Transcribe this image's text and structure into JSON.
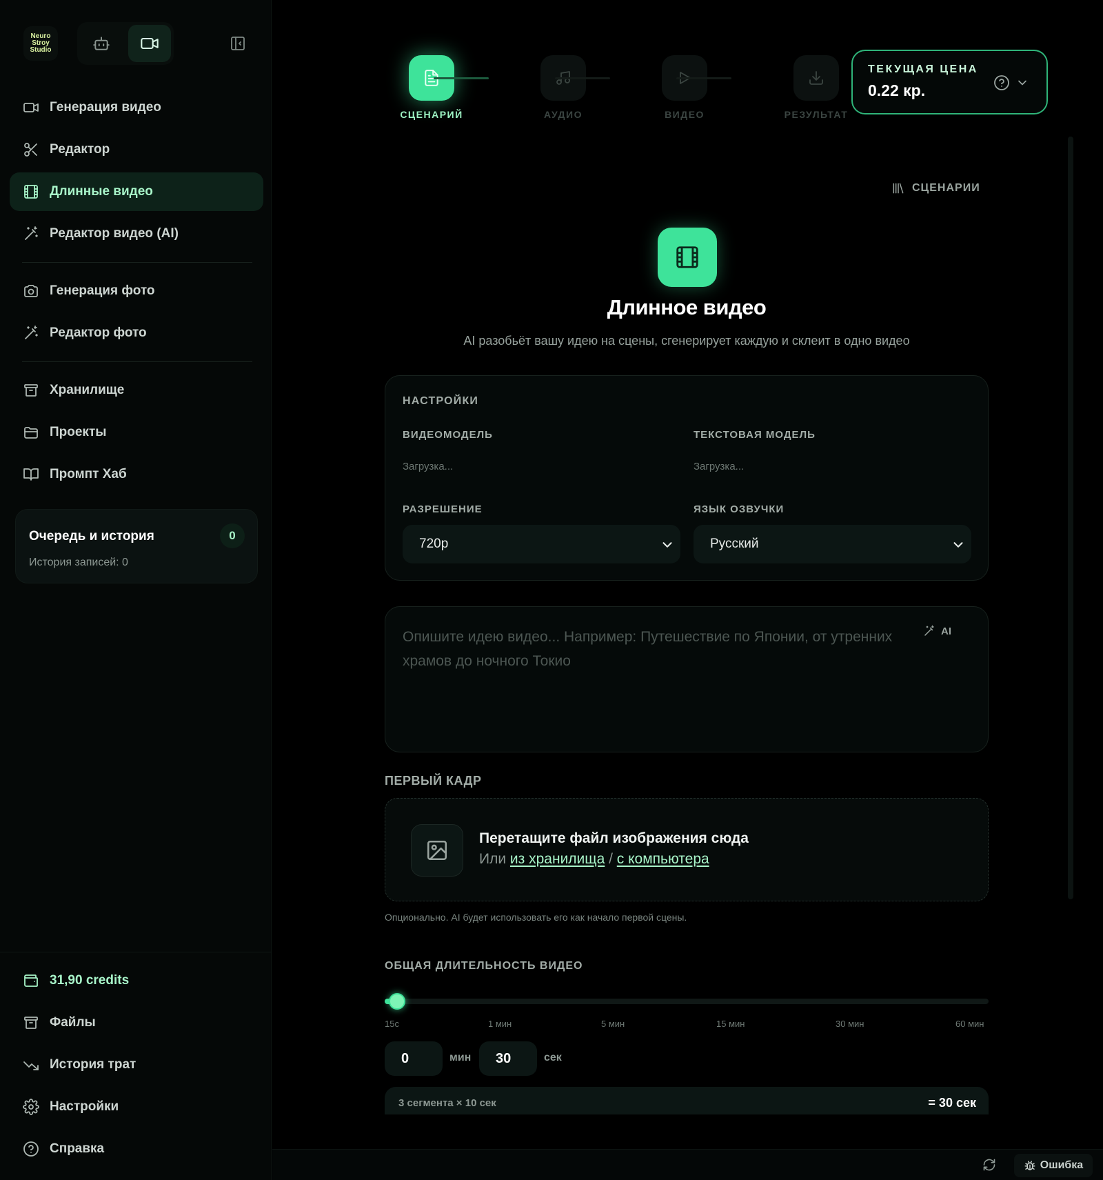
{
  "sidebar": {
    "logo_lines": [
      "Neuro",
      "Stroy",
      "Studio"
    ],
    "nav": [
      {
        "label": "Генерация видео",
        "icon": "video-icon",
        "active": false
      },
      {
        "label": "Редактор",
        "icon": "scissors-icon",
        "active": false
      },
      {
        "label": "Длинные видео",
        "icon": "film-icon",
        "active": true
      },
      {
        "label": "Редактор видео (AI)",
        "icon": "magic-wand-icon",
        "active": false
      },
      {
        "label": "Генерация фото",
        "icon": "camera-icon",
        "active": false
      },
      {
        "label": "Редактор фото",
        "icon": "magic-wand-icon",
        "active": false
      },
      {
        "label": "Хранилище",
        "icon": "archive-icon",
        "active": false
      },
      {
        "label": "Проекты",
        "icon": "folder-icon",
        "active": false
      },
      {
        "label": "Промпт Хаб",
        "icon": "book-icon",
        "active": false
      }
    ],
    "queue": {
      "title": "Очередь и история",
      "count": "0",
      "subtitle": "История записей: 0"
    },
    "bottom": [
      {
        "label": "31,90 credits",
        "icon": "wallet-icon"
      },
      {
        "label": "Файлы",
        "icon": "archive-icon"
      },
      {
        "label": "История трат",
        "icon": "trend-down-icon"
      },
      {
        "label": "Настройки",
        "icon": "gear-icon"
      },
      {
        "label": "Справка",
        "icon": "help-icon"
      }
    ]
  },
  "stepper": {
    "steps": [
      {
        "label": "СЦЕНАРИЙ",
        "icon": "document-icon",
        "active": true
      },
      {
        "label": "АУДИО",
        "icon": "music-icon",
        "active": false
      },
      {
        "label": "ВИДЕО",
        "icon": "play-icon",
        "active": false
      },
      {
        "label": "РЕЗУЛЬТАТ",
        "icon": "download-icon",
        "active": false
      }
    ]
  },
  "price": {
    "label": "ТЕКУЩАЯ ЦЕНА",
    "value": "0.22 кр."
  },
  "scenarios_link": "СЦЕНАРИИ",
  "hero": {
    "title": "Длинное видео",
    "subtitle": "AI разобьёт вашу идею на сцены, сгенерирует каждую и склеит в одно видео"
  },
  "settings": {
    "title": "НАСТРОЙКИ",
    "video_model_label": "ВИДЕОМОДЕЛЬ",
    "video_model_value": "Загрузка...",
    "text_model_label": "ТЕКСТОВАЯ МОДЕЛЬ",
    "text_model_value": "Загрузка...",
    "resolution_label": "РАЗРЕШЕНИЕ",
    "resolution_value": "720p",
    "voice_lang_label": "ЯЗЫК ОЗВУЧКИ",
    "voice_lang_value": "Русский"
  },
  "idea": {
    "placeholder": "Опишите идею видео... Например: Путешествие по Японии, от утренних храмов до ночного Токио",
    "ai_label": "AI"
  },
  "first_frame": {
    "title": "ПЕРВЫЙ КАДР",
    "drop_title": "Перетащите файл изображения сюда",
    "or": "Или",
    "link_storage": "из хранилища",
    "sep": "/",
    "link_computer": "с компьютера",
    "hint": "Опционально. AI будет использовать его как начало первой сцены."
  },
  "duration": {
    "title": "ОБЩАЯ ДЛИТЕЛЬНОСТЬ ВИДЕО",
    "slider_fraction": 0.02,
    "ticks": [
      "15с",
      "1 мин",
      "5 мин",
      "15 мин",
      "30 мин",
      "60 мин"
    ],
    "minutes": "0",
    "minutes_unit": "мин",
    "seconds": "30",
    "seconds_unit": "сек",
    "summary_left": "3 сегмента × 10 сек",
    "summary_right": "= 30 сек"
  },
  "statusbar": {
    "error_label": "Ошибка"
  },
  "colors": {
    "accent": "#3ee39a",
    "accent_text": "#a8f5c9",
    "background": "#000000"
  }
}
